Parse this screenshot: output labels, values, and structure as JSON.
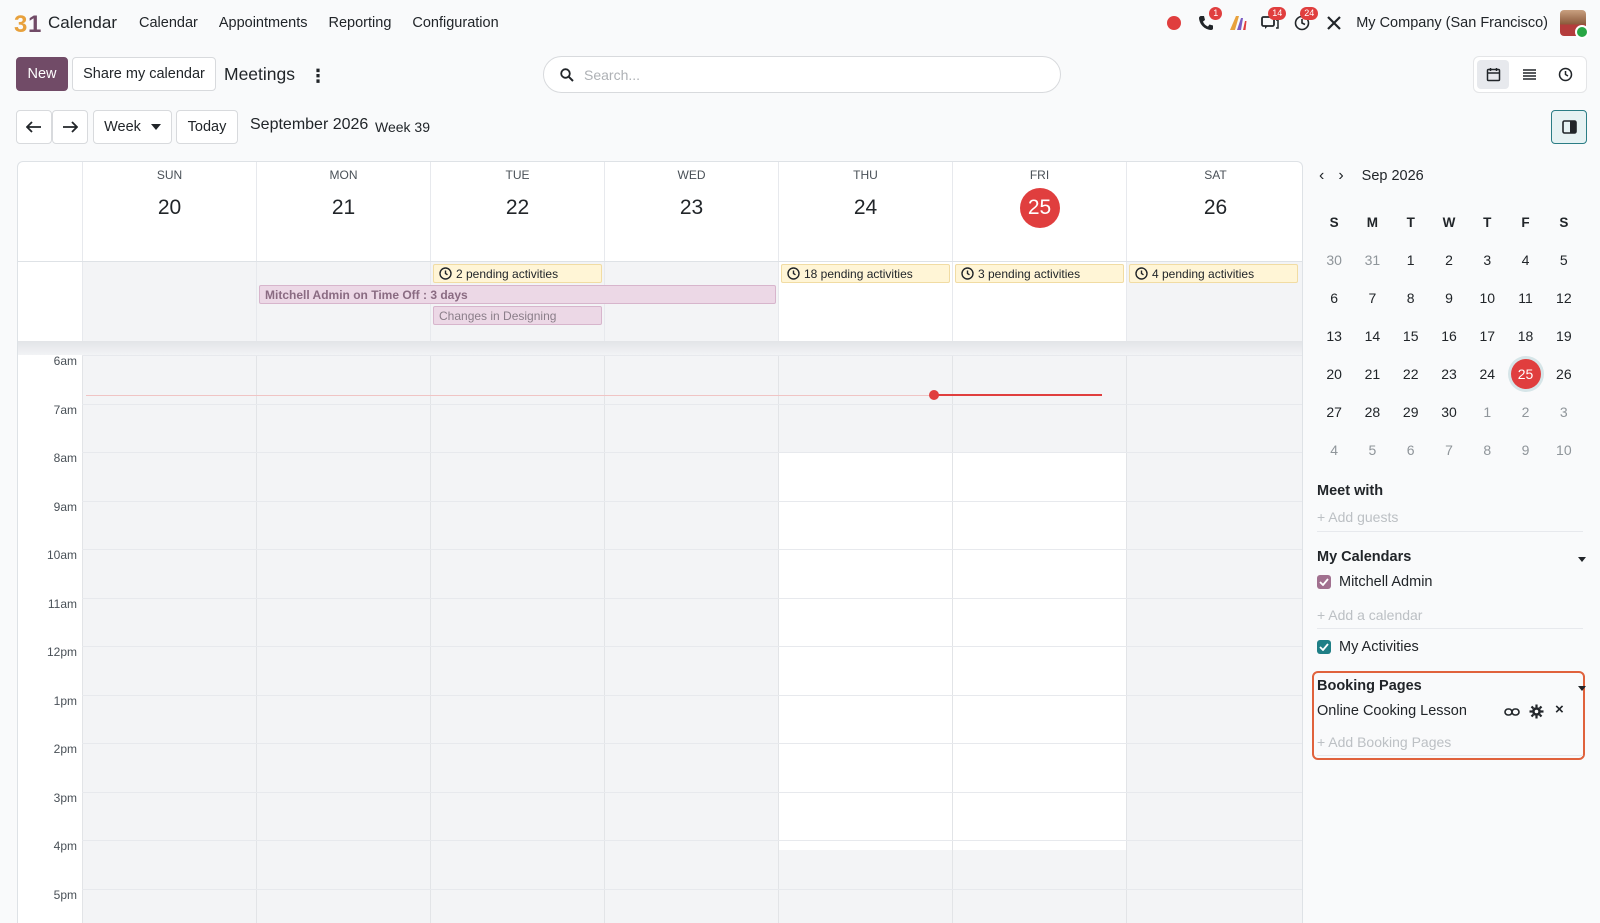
{
  "navbar": {
    "logo_text": "31",
    "app_name": "Calendar",
    "menu": [
      "Calendar",
      "Appointments",
      "Reporting",
      "Configuration"
    ],
    "badges": {
      "phone": "1",
      "messages": "14",
      "activities": "24"
    },
    "company": "My Company (San Francisco)"
  },
  "control": {
    "new_label": "New",
    "share_label": "Share my calendar",
    "title": "Meetings",
    "search_placeholder": "Search...",
    "scale_label": "Week",
    "today_label": "Today",
    "period": "September 2026",
    "week": "Week 39"
  },
  "calendar": {
    "days": [
      {
        "dow": "SUN",
        "num": "20"
      },
      {
        "dow": "MON",
        "num": "21"
      },
      {
        "dow": "TUE",
        "num": "22"
      },
      {
        "dow": "WED",
        "num": "23"
      },
      {
        "dow": "THU",
        "num": "24"
      },
      {
        "dow": "FRI",
        "num": "25",
        "today": true
      },
      {
        "dow": "SAT",
        "num": "26"
      }
    ],
    "allday_events": {
      "tue_pending": "2 pending activities",
      "thu_pending": "18 pending activities",
      "fri_pending": "3 pending activities",
      "sat_pending": "4 pending activities",
      "timeoff": "Mitchell Admin on Time Off : 3 days",
      "design": "Changes in Designing"
    },
    "hours": [
      "6am",
      "7am",
      "8am",
      "9am",
      "10am",
      "11am",
      "12pm",
      "1pm",
      "2pm",
      "3pm",
      "4pm",
      "5pm"
    ]
  },
  "sidebar": {
    "month_label": "Sep 2026",
    "weekday_headers": [
      "S",
      "M",
      "T",
      "W",
      "T",
      "F",
      "S"
    ],
    "weeks": [
      [
        "30",
        "31",
        "1",
        "2",
        "3",
        "4",
        "5"
      ],
      [
        "6",
        "7",
        "8",
        "9",
        "10",
        "11",
        "12"
      ],
      [
        "13",
        "14",
        "15",
        "16",
        "17",
        "18",
        "19"
      ],
      [
        "20",
        "21",
        "22",
        "23",
        "24",
        "25",
        "26"
      ],
      [
        "27",
        "28",
        "29",
        "30",
        "1",
        "2",
        "3"
      ],
      [
        "4",
        "5",
        "6",
        "7",
        "8",
        "9",
        "10"
      ]
    ],
    "meet_with": "Meet with",
    "add_guests": "+ Add guests",
    "my_calendars": "My Calendars",
    "calendar_user": "Mitchell Admin",
    "add_calendar": "+ Add a calendar",
    "my_activities": "My Activities",
    "booking_pages": "Booking Pages",
    "booking_item": "Online Cooking Lesson",
    "add_booking": "+ Add Booking Pages"
  },
  "colors": {
    "brand": "#714b67",
    "accent_teal": "#2b7d85",
    "today_red": "#e03e3e",
    "highlight_orange": "#e0623c"
  }
}
